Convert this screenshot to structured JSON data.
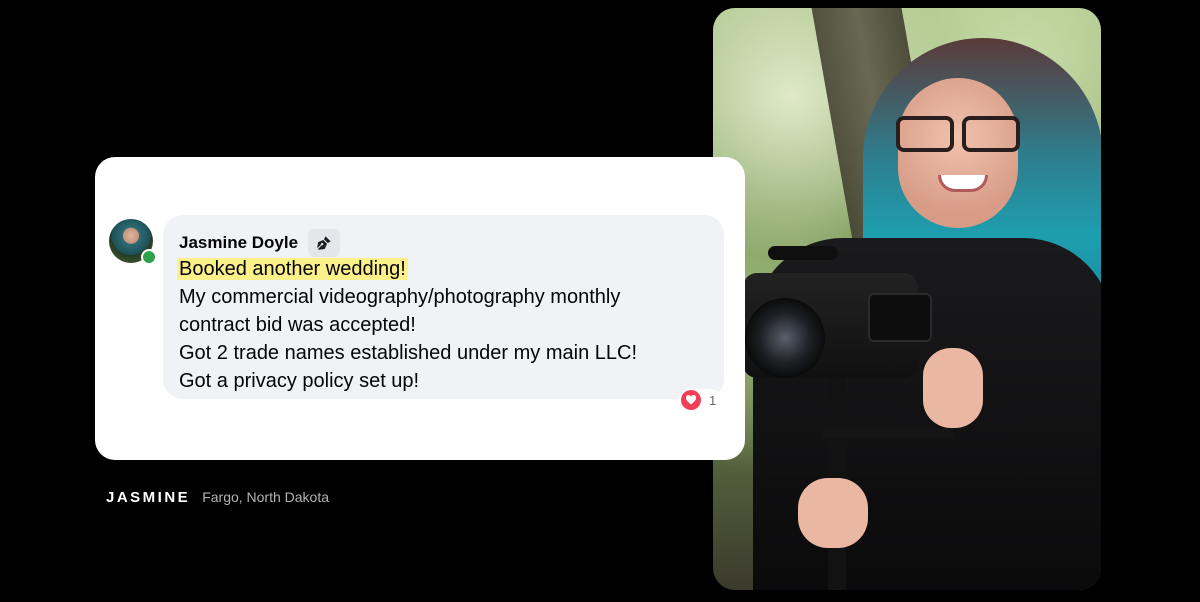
{
  "comment": {
    "author": "Jasmine Doyle",
    "badge_icon": "pen-nib-icon",
    "highlighted_line": "Booked another wedding!",
    "lines": [
      "My commercial videography/photography monthly",
      "contract bid was accepted!",
      "Got 2 trade names established under my main LLC!",
      "Got a privacy policy set up!"
    ],
    "reaction_icon": "heart-icon",
    "reaction_count": "1",
    "online_status_color": "#31a24c",
    "highlight_color": "#fbf08a"
  },
  "caption": {
    "name": "JASMINE",
    "location": "Fargo, North Dakota"
  }
}
